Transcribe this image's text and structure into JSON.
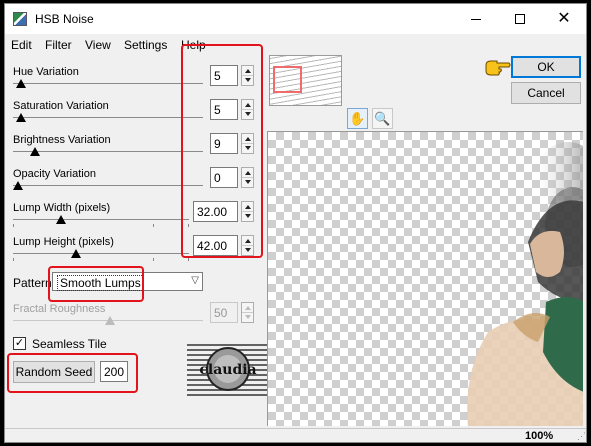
{
  "window": {
    "title": "HSB Noise"
  },
  "menu": [
    "Edit",
    "Filter",
    "View",
    "Settings",
    "Help"
  ],
  "sliders": [
    {
      "label": "Hue Variation",
      "value": "5"
    },
    {
      "label": "Saturation Variation",
      "value": "5"
    },
    {
      "label": "Brightness Variation",
      "value": "9"
    },
    {
      "label": "Opacity Variation",
      "value": "0"
    },
    {
      "label": "Lump Width (pixels)",
      "value": "32.00"
    },
    {
      "label": "Lump Height (pixels)",
      "value": "42.00"
    }
  ],
  "pattern": {
    "label": "Pattern",
    "selected": "Smooth Lumps"
  },
  "fractal": {
    "label": "Fractal Roughness",
    "value": "50",
    "enabled": false
  },
  "seamless": {
    "label": "Seamless Tile",
    "checked": true
  },
  "random_seed": {
    "label": "Random Seed",
    "value": "200"
  },
  "buttons": {
    "ok": "OK",
    "cancel": "Cancel"
  },
  "watermark_text": "claudia",
  "status": {
    "zoom": "100%"
  },
  "icons": {
    "hand": "hand-tool-icon",
    "zoom": "magnifier-icon",
    "pointer": "pointing-hand-icon"
  },
  "colors": {
    "highlight": "#e2131b",
    "accent": "#0078d7"
  }
}
